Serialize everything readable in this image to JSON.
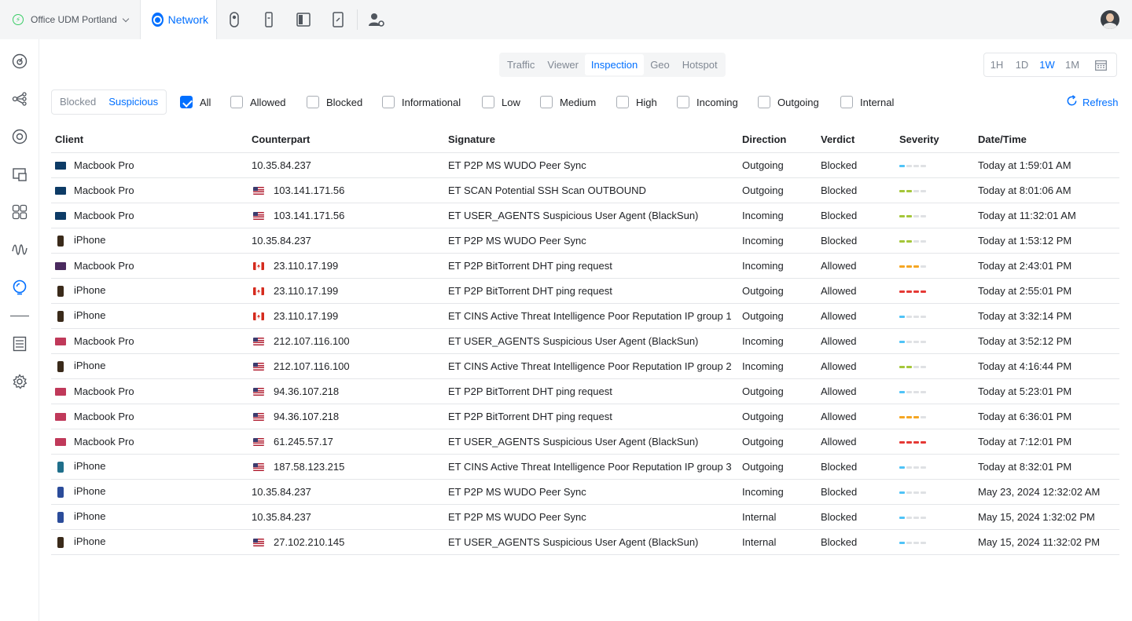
{
  "topbar": {
    "site_name": "Office UDM Portland",
    "app_tab": "Network"
  },
  "views": [
    "Traffic",
    "Viewer",
    "Inspection",
    "Geo",
    "Hotspot"
  ],
  "active_view": "Inspection",
  "ranges": [
    "1H",
    "1D",
    "1W",
    "1M"
  ],
  "active_range": "1W",
  "filter_toggle": [
    "Blocked",
    "Suspicious"
  ],
  "active_filter": "Suspicious",
  "checkboxes": [
    {
      "label": "All",
      "checked": true
    },
    {
      "label": "Allowed",
      "checked": false
    },
    {
      "label": "Blocked",
      "checked": false
    },
    {
      "label": "Informational",
      "checked": false
    },
    {
      "label": "Low",
      "checked": false
    },
    {
      "label": "Medium",
      "checked": false
    },
    {
      "label": "High",
      "checked": false
    },
    {
      "label": "Incoming",
      "checked": false
    },
    {
      "label": "Outgoing",
      "checked": false
    },
    {
      "label": "Internal",
      "checked": false
    }
  ],
  "refresh_label": "Refresh",
  "columns": [
    "Client",
    "Counterpart",
    "Signature",
    "Direction",
    "Verdict",
    "Severity",
    "Date/Time"
  ],
  "severity_colors": {
    "1": "#4fc3f7",
    "2": "#a4c639",
    "3": "#f5a623",
    "4": "#e53935"
  },
  "rows": [
    {
      "device": "mac",
      "dev_color": "#0d3b66",
      "client": "Macbook Pro",
      "flag": "",
      "counterpart": "10.35.84.237",
      "signature": "ET P2P MS WUDO Peer Sync",
      "direction": "Outgoing",
      "verdict": "Blocked",
      "severity": 1,
      "datetime": "Today at 1:59:01 AM"
    },
    {
      "device": "mac",
      "dev_color": "#0d3b66",
      "client": "Macbook Pro",
      "flag": "us",
      "counterpart": "103.141.171.56",
      "signature": "ET SCAN Potential SSH Scan OUTBOUND",
      "direction": "Outgoing",
      "verdict": "Blocked",
      "severity": 2,
      "datetime": "Today at 8:01:06 AM"
    },
    {
      "device": "mac",
      "dev_color": "#0d3b66",
      "client": "Macbook Pro",
      "flag": "us",
      "counterpart": "103.141.171.56",
      "signature": "ET USER_AGENTS Suspicious User Agent (BlackSun)",
      "direction": "Incoming",
      "verdict": "Blocked",
      "severity": 2,
      "datetime": "Today at 11:32:01 AM"
    },
    {
      "device": "phone",
      "dev_color": "#3a2a1a",
      "client": "iPhone",
      "flag": "",
      "counterpart": "10.35.84.237",
      "signature": "ET P2P MS WUDO Peer Sync",
      "direction": "Incoming",
      "verdict": "Blocked",
      "severity": 2,
      "datetime": "Today at 1:53:12 PM"
    },
    {
      "device": "mac",
      "dev_color": "#4a2a5e",
      "client": "Macbook Pro",
      "flag": "ca",
      "counterpart": "23.110.17.199",
      "signature": "ET P2P BitTorrent DHT ping request",
      "direction": "Incoming",
      "verdict": "Allowed",
      "severity": 3,
      "datetime": "Today at 2:43:01 PM"
    },
    {
      "device": "phone",
      "dev_color": "#3a2a1a",
      "client": "iPhone",
      "flag": "ca",
      "counterpart": "23.110.17.199",
      "signature": "ET P2P BitTorrent DHT ping request",
      "direction": "Outgoing",
      "verdict": "Allowed",
      "severity": 4,
      "datetime": "Today at 2:55:01 PM"
    },
    {
      "device": "phone",
      "dev_color": "#3a2a1a",
      "client": "iPhone",
      "flag": "ca",
      "counterpart": "23.110.17.199",
      "signature": "ET CINS Active Threat Intelligence Poor Reputation IP group 1",
      "direction": "Outgoing",
      "verdict": "Allowed",
      "severity": 1,
      "datetime": "Today at 3:32:14 PM"
    },
    {
      "device": "mac",
      "dev_color": "#c0395a",
      "client": "Macbook Pro",
      "flag": "us",
      "counterpart": "212.107.116.100",
      "signature": "ET USER_AGENTS Suspicious User Agent (BlackSun)",
      "direction": "Incoming",
      "verdict": "Allowed",
      "severity": 1,
      "datetime": "Today at 3:52:12 PM"
    },
    {
      "device": "phone",
      "dev_color": "#3a2a1a",
      "client": "iPhone",
      "flag": "us",
      "counterpart": "212.107.116.100",
      "signature": "ET CINS Active Threat Intelligence Poor Reputation IP group 2",
      "direction": "Incoming",
      "verdict": "Allowed",
      "severity": 2,
      "datetime": "Today at 4:16:44 PM"
    },
    {
      "device": "mac",
      "dev_color": "#c0395a",
      "client": "Macbook Pro",
      "flag": "us",
      "counterpart": "94.36.107.218",
      "signature": "ET P2P BitTorrent DHT ping request",
      "direction": "Outgoing",
      "verdict": "Allowed",
      "severity": 1,
      "datetime": "Today at 5:23:01 PM"
    },
    {
      "device": "mac",
      "dev_color": "#c0395a",
      "client": "Macbook Pro",
      "flag": "us",
      "counterpart": "94.36.107.218",
      "signature": "ET P2P BitTorrent DHT ping request",
      "direction": "Outgoing",
      "verdict": "Allowed",
      "severity": 3,
      "datetime": "Today at 6:36:01 PM"
    },
    {
      "device": "mac",
      "dev_color": "#c0395a",
      "client": "Macbook Pro",
      "flag": "us",
      "counterpart": "61.245.57.17",
      "signature": "ET USER_AGENTS Suspicious User Agent (BlackSun)",
      "direction": "Outgoing",
      "verdict": "Allowed",
      "severity": 4,
      "datetime": "Today at 7:12:01 PM"
    },
    {
      "device": "phone",
      "dev_color": "#1f6f8b",
      "client": "iPhone",
      "flag": "us",
      "counterpart": "187.58.123.215",
      "signature": "ET CINS Active Threat Intelligence Poor Reputation IP group 3",
      "direction": "Outgoing",
      "verdict": "Blocked",
      "severity": 1,
      "datetime": "Today at 8:32:01 PM"
    },
    {
      "device": "phone",
      "dev_color": "#2b4c9a",
      "client": "iPhone",
      "flag": "",
      "counterpart": "10.35.84.237",
      "signature": "ET P2P MS WUDO Peer Sync",
      "direction": "Incoming",
      "verdict": "Blocked",
      "severity": 1,
      "datetime": "May 23, 2024 12:32:02 AM"
    },
    {
      "device": "phone",
      "dev_color": "#2b4c9a",
      "client": "iPhone",
      "flag": "",
      "counterpart": "10.35.84.237",
      "signature": "ET P2P MS WUDO Peer Sync",
      "direction": "Internal",
      "verdict": "Blocked",
      "severity": 1,
      "datetime": "May 15, 2024 1:32:02 PM"
    },
    {
      "device": "phone",
      "dev_color": "#3a2a1a",
      "client": "iPhone",
      "flag": "us",
      "counterpart": "27.102.210.145",
      "signature": "ET USER_AGENTS Suspicious User Agent (BlackSun)",
      "direction": "Internal",
      "verdict": "Blocked",
      "severity": 1,
      "datetime": "May 15, 2024 11:32:02 PM"
    }
  ]
}
